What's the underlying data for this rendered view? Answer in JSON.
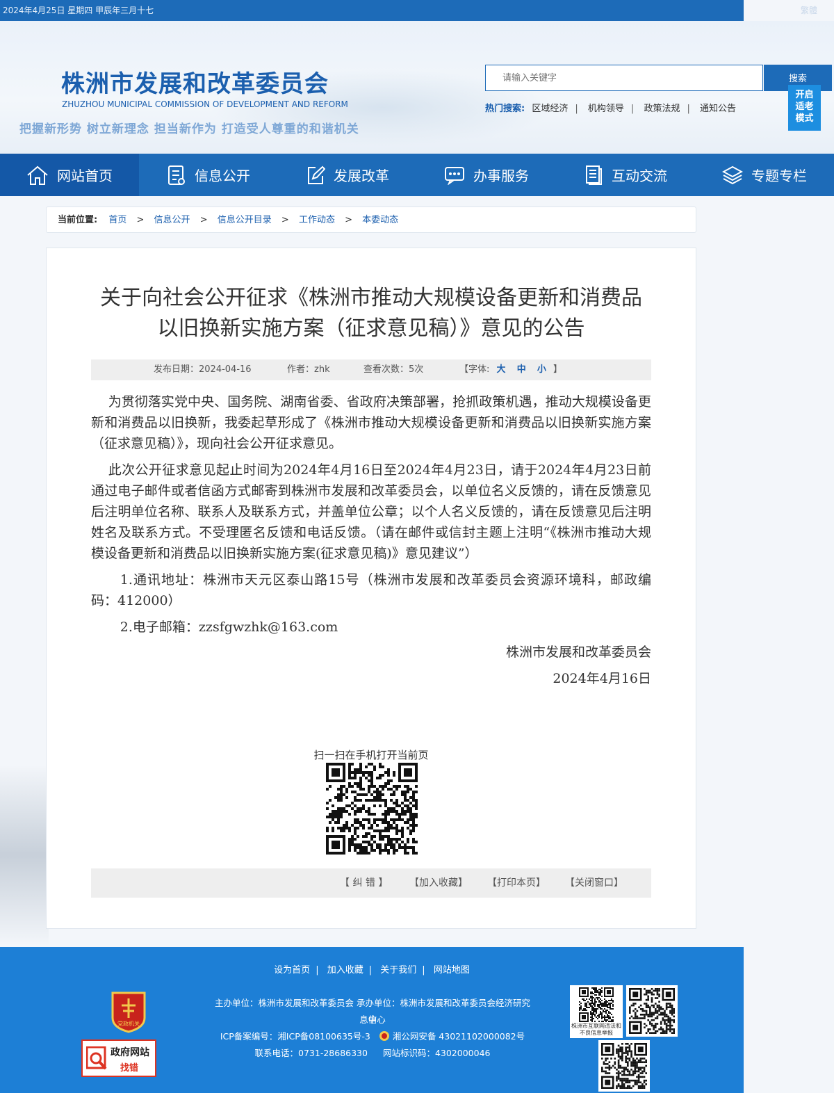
{
  "topbar": {
    "date": "2024年4月25日   星期四   甲辰年三月十七",
    "lang": "繁體"
  },
  "header": {
    "title": "株洲市发展和改革委员会",
    "title_en": "ZHUZHOU MUNICIPAL COMMISSION OF DEVELOPMENT AND REFORM",
    "slogan": "把握新形势 树立新理念 担当新作为 打造受人尊重的和谐机关",
    "search_placeholder": "请输入关键字",
    "search_button": "搜索",
    "elder_mode": [
      "开启",
      "适老",
      "模式"
    ],
    "hot_label": "热门搜索:",
    "hot_items": [
      "区域经济",
      "机构领导",
      "政策法规",
      "通知公告"
    ]
  },
  "nav": [
    {
      "label": "网站首页",
      "icon": "home-icon"
    },
    {
      "label": "信息公开",
      "icon": "document-list-icon"
    },
    {
      "label": "发展改革",
      "icon": "edit-icon"
    },
    {
      "label": "办事服务",
      "icon": "chat-icon"
    },
    {
      "label": "互动交流",
      "icon": "notes-icon"
    },
    {
      "label": "专题专栏",
      "icon": "layers-icon"
    }
  ],
  "breadcrumb": {
    "label": "当前位置:",
    "items": [
      "首页",
      "信息公开",
      "信息公开目录",
      "工作动态",
      "本委动态"
    ],
    "sep": ">"
  },
  "article": {
    "title_line1": "关于向社会公开征求《株洲市推动大规模设备更新和消费品",
    "title_line2": "以旧换新实施方案（征求意见稿）》意见的公告",
    "meta": {
      "date": "发布日期：2024-04-16",
      "author": "作者：zhk",
      "views": "查看次数：5次",
      "font_label": "【字体:",
      "font_sizes": [
        "大",
        "中",
        "小"
      ],
      "font_end": "】"
    },
    "paragraphs": [
      "为贯彻落实党中央、国务院、湖南省委、省政府决策部署，抢抓政策机遇，推动大规模设备更新和消费品以旧换新，我委起草形成了《株洲市推动大规模设备更新和消费品以旧换新实施方案（征求意见稿）》，现向社会公开征求意见。",
      "此次公开征求意见起止时间为2024年4月16日至2024年4月23日，请于2024年4月23日前通过电子邮件或者信函方式邮寄到株洲市发展和改革委员会，以单位名义反馈的，请在反馈意见后注明单位名称、联系人及联系方式，并盖单位公章；以个人名义反馈的，请在反馈意见后注明姓名及联系方式。不受理匿名反馈和电话反馈。（请在邮件或信封主题上注明“《株洲市推动大规模设备更新和消费品以旧换新实施方案(征求意见稿)》意见建议”）",
      "1.通讯地址：株洲市天元区泰山路15号（株洲市发展和改革委员会资源环境科，邮政编码：412000）",
      "2.电子邮箱：zzsfgwzhk@163.com"
    ],
    "signature": "株洲市发展和改革委员会",
    "sign_date": "2024年4月16日",
    "qr_title": "扫一扫在手机打开当前页",
    "tools": [
      "【 纠 错 】",
      "【加入收藏】",
      "【打印本页】",
      "【关闭窗口】"
    ]
  },
  "footer": {
    "links": [
      "设为首页",
      "加入收藏",
      "关于我们",
      "网站地图"
    ],
    "sponsor": "主办单位：株洲市发展和改革委员会 承办单位：株洲市发展和改革委员会经济研究信",
    "sponsor2": "息中心",
    "icp": "ICP备案编号：湘ICP备08100635号-3",
    "police": "湘公网安备 43021102000082号",
    "phone": "联系电话：0731-28686330",
    "site_id": "网站标识码：4302000046",
    "badge_text": "党政机关",
    "gov_error_1": "政府网站",
    "gov_error_2": "找错",
    "qr_caption": "株洲市互联网违法和不良信息举报"
  },
  "colors": {
    "primary": "#1d6bb8",
    "nav_active": "#1458a7",
    "footer": "#1d7fd6",
    "link": "#1b5fae"
  }
}
